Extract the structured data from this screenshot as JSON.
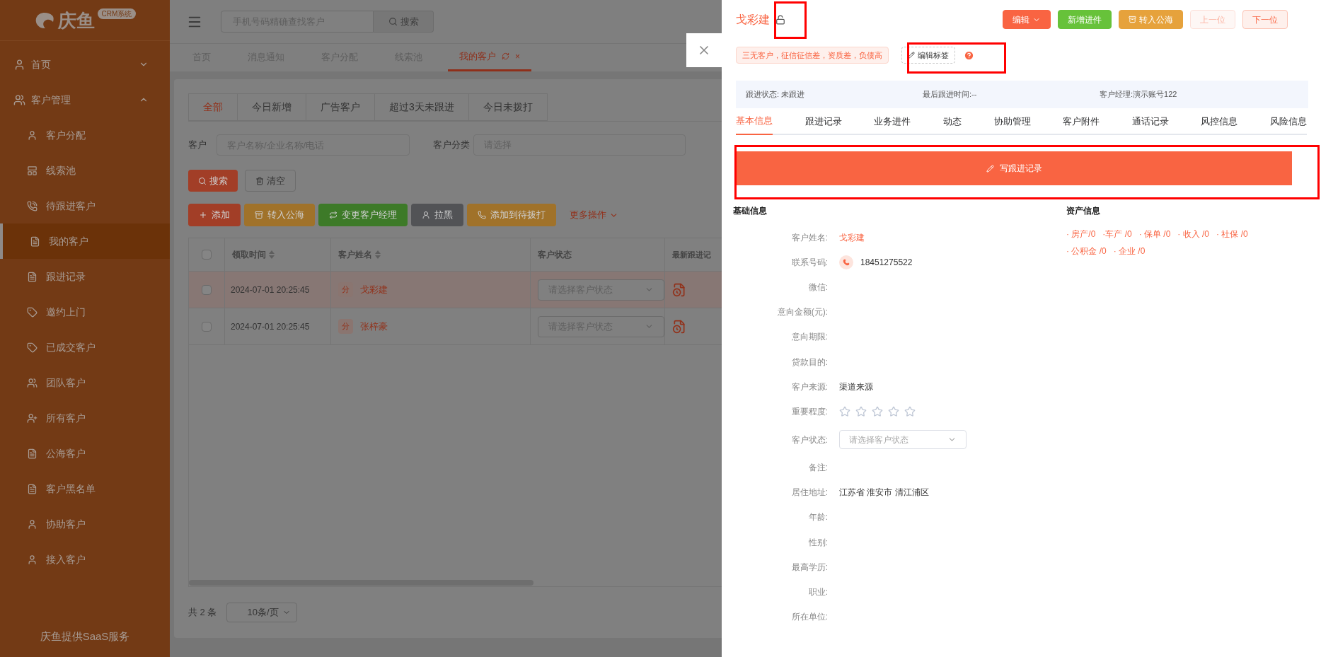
{
  "sidebar": {
    "logo": {
      "name": "庆鱼",
      "badge": "CRM系统"
    },
    "items": [
      {
        "label": "首页",
        "expanded": false
      },
      {
        "label": "客户管理",
        "expanded": true,
        "children": [
          {
            "label": "客户分配",
            "selected": false
          },
          {
            "label": "线索池",
            "selected": false
          },
          {
            "label": "待跟进客户",
            "selected": false
          },
          {
            "label": "我的客户",
            "selected": true
          },
          {
            "label": "跟进记录",
            "selected": false
          },
          {
            "label": "邀约上门",
            "selected": false
          },
          {
            "label": "已成交客户",
            "selected": false
          },
          {
            "label": "团队客户",
            "selected": false
          },
          {
            "label": "所有客户",
            "selected": false
          },
          {
            "label": "公海客户",
            "selected": false
          },
          {
            "label": "客户黑名单",
            "selected": false
          },
          {
            "label": "协助客户",
            "selected": false
          },
          {
            "label": "接入客户",
            "selected": false
          }
        ]
      }
    ],
    "footer": "庆鱼提供SaaS服务"
  },
  "header": {
    "search": {
      "placeholder": "手机号码精确查找客户",
      "button": "搜索"
    }
  },
  "page_tabs": [
    {
      "label": "首页",
      "selected": false
    },
    {
      "label": "消息通知",
      "selected": false
    },
    {
      "label": "客户分配",
      "selected": false
    },
    {
      "label": "线索池",
      "selected": false
    },
    {
      "label": "我的客户",
      "selected": true,
      "close": "×"
    }
  ],
  "filter_tabs": [
    {
      "label": "全部",
      "selected": true
    },
    {
      "label": "今日新增",
      "selected": false
    },
    {
      "label": "广告客户",
      "selected": false
    },
    {
      "label": "超过3天未跟进",
      "selected": false
    },
    {
      "label": "今日未拨打",
      "selected": false
    }
  ],
  "filters": {
    "customer": {
      "label": "客户",
      "placeholder": "客户名称/企业名称/电话"
    },
    "category": {
      "label": "客户分类",
      "placeholder": "请选择"
    },
    "search_button": "搜索",
    "clear_button": "清空"
  },
  "actions": [
    {
      "label": "添加",
      "color": "#a23e27"
    },
    {
      "label": "转入公海",
      "color": "#a0722a"
    },
    {
      "label": "变更客户经理",
      "color": "#3d7a28"
    },
    {
      "label": "拉黑",
      "color": "#525356"
    },
    {
      "label": "添加到待拨打",
      "color": "#a0722a"
    }
  ],
  "more_actions": "更多操作",
  "table": {
    "all_checked": false,
    "columns": [
      "领取时间",
      "客户姓名",
      "客户状态",
      "最新跟进记"
    ],
    "rows": [
      {
        "checked": false,
        "selected": true,
        "time": "2024-07-01 20:25:45",
        "badge": "分",
        "name": "戈彩建",
        "status_placeholder": "请选择客户状态"
      },
      {
        "checked": false,
        "selected": false,
        "time": "2024-07-01 20:25:45",
        "badge": "分",
        "name": "张梓豪",
        "status_placeholder": "请选择客户状态"
      }
    ]
  },
  "pagination": {
    "total": "共 2 条",
    "page_size": "10条/页"
  },
  "drawer": {
    "title": "戈彩建",
    "locked": false,
    "buttons": [
      {
        "label": "编辑",
        "kind": "primary",
        "dropdown": true,
        "disabled": false
      },
      {
        "label": "新增进件",
        "kind": "success",
        "dropdown": false,
        "disabled": false
      },
      {
        "label": "转入公海",
        "kind": "warning",
        "dropdown": false,
        "disabled": false
      },
      {
        "label": "上一位",
        "kind": "plain",
        "dropdown": false,
        "disabled": true
      },
      {
        "label": "下一位",
        "kind": "plain",
        "dropdown": false,
        "disabled": false
      }
    ],
    "tag": "三无客户，征信征信差，资质差，负债高",
    "edit_tags": "编辑标签",
    "info_bar": [
      "跟进状态: 未跟进",
      "最后跟进时间:--",
      "客户经理:演示账号122"
    ],
    "tabs": [
      {
        "label": "基本信息",
        "selected": true
      },
      {
        "label": "跟进记录",
        "selected": false
      },
      {
        "label": "业务进件",
        "selected": false
      },
      {
        "label": "动态",
        "selected": false
      },
      {
        "label": "协助管理",
        "selected": false
      },
      {
        "label": "客户附件",
        "selected": false
      },
      {
        "label": "通话记录",
        "selected": false
      },
      {
        "label": "风控信息",
        "selected": false
      },
      {
        "label": "风险信息",
        "selected": false
      }
    ],
    "write_button": "写跟进记录",
    "basic_title": "基础信息",
    "fields": [
      {
        "label": "客户姓名:",
        "kind": "name",
        "value": "戈彩建"
      },
      {
        "label": "联系号码:",
        "kind": "phone",
        "value": "18451275522"
      },
      {
        "label": "微信:",
        "kind": "text"
      },
      {
        "label": "意向金额(元):",
        "kind": "text"
      },
      {
        "label": "意向期限:",
        "kind": "text"
      },
      {
        "label": "贷款目的:",
        "kind": "text"
      },
      {
        "label": "客户来源:",
        "kind": "text",
        "value": "渠道来源"
      },
      {
        "label": "重要程度:",
        "kind": "stars",
        "stars": 0
      },
      {
        "label": "客户状态:",
        "kind": "select",
        "placeholder": "请选择客户状态"
      },
      {
        "label": "备注:",
        "kind": "text"
      },
      {
        "label": "居住地址:",
        "kind": "text",
        "value": "江苏省 淮安市 清江浦区"
      },
      {
        "label": "年龄:",
        "kind": "text"
      },
      {
        "label": "性别:",
        "kind": "text"
      },
      {
        "label": "最高学历:",
        "kind": "text"
      },
      {
        "label": "职业:",
        "kind": "text"
      },
      {
        "label": "所在单位:",
        "kind": "text"
      }
    ],
    "asset_title": "资产信息",
    "assets": [
      "· 房产/0",
      "·车产 /0",
      "· 保单 /0",
      "· 收入 /0",
      "· 社保 /0",
      "· 公积金 /0",
      "· 企业 /0"
    ]
  }
}
